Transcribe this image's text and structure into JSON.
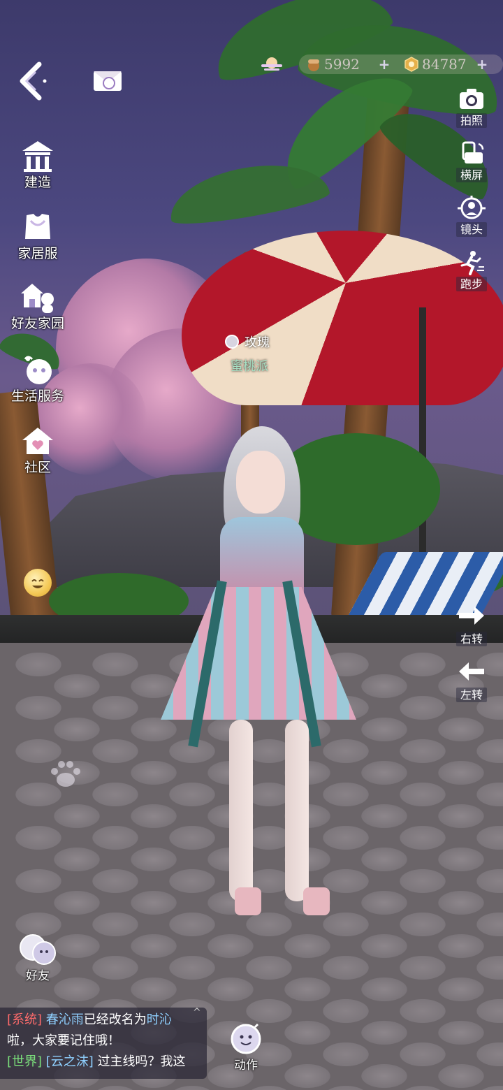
{
  "hud": {
    "back_icon": "back-chevron-icon",
    "mail_icon": "mail-icon",
    "landscape_icon": "sunset-icon",
    "currency": [
      {
        "icon": "acorn-coin-icon",
        "value": "5992",
        "color": "#c9873e"
      },
      {
        "icon": "gold-coin-icon",
        "value": "84787",
        "color": "#e6b04a"
      }
    ]
  },
  "left_menu": [
    {
      "label": "建造",
      "icon": "build-icon"
    },
    {
      "label": "家居服",
      "icon": "homewear-icon"
    },
    {
      "label": "好友家园",
      "icon": "friend-home-icon"
    },
    {
      "label": "生活服务",
      "icon": "life-service-icon"
    },
    {
      "label": "社区",
      "icon": "community-icon"
    }
  ],
  "right_menu": [
    {
      "label": "拍照",
      "icon": "camera-icon"
    },
    {
      "label": "横屏",
      "icon": "rotate-screen-icon"
    },
    {
      "label": "镜头",
      "icon": "lens-icon"
    },
    {
      "label": "跑步",
      "icon": "run-icon"
    }
  ],
  "rotate": [
    {
      "label": "右转",
      "icon": "arrow-right-icon"
    },
    {
      "label": "左转",
      "icon": "arrow-left-icon"
    }
  ],
  "player": {
    "name": "玫瑰",
    "guild": "蜜桃派"
  },
  "bottom": {
    "friends_label": "好友",
    "action_label": "动作",
    "toggle_glyph": "^"
  },
  "chat": [
    {
      "channel": "[系统]",
      "name": "春沁雨",
      "text1": "已经改名为",
      "name2": "时沁"
    },
    {
      "text": "啦，大家要记住哦！"
    },
    {
      "channel": "[世界]",
      "name": "[云之沫]",
      "text": "过主线吗？我这"
    }
  ],
  "colors": {
    "accent": "#ffffff",
    "system": "#ff6b6b",
    "world": "#7be07b",
    "player_name": "#8fd0ff",
    "guild": "#a7e0c4"
  }
}
